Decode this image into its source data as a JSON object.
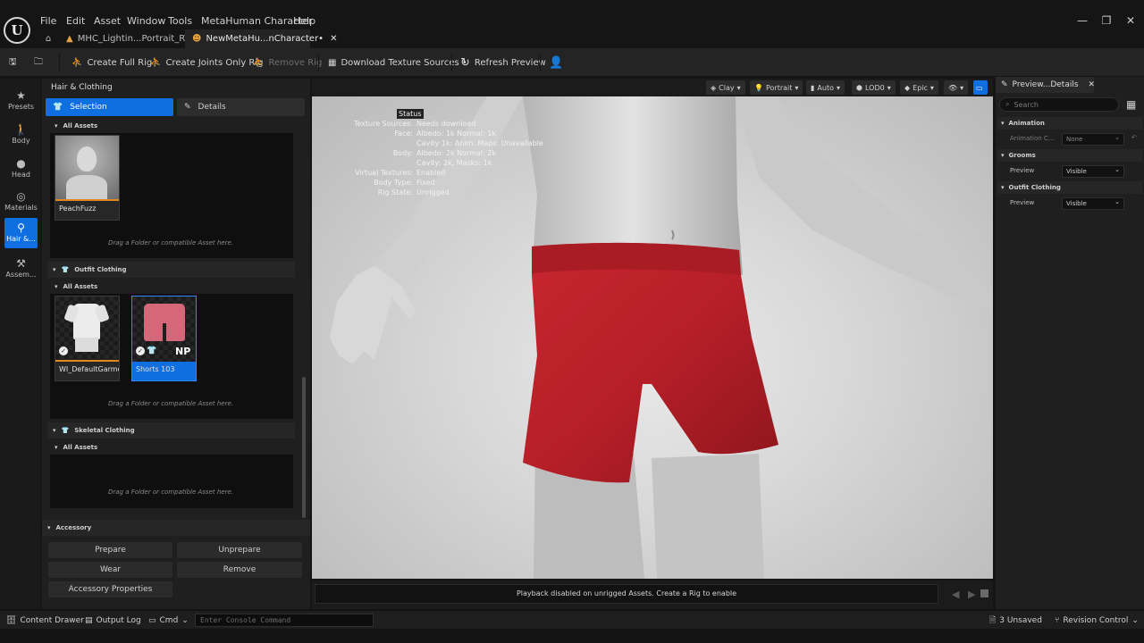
{
  "app": {
    "logo_text": "U"
  },
  "menu": [
    "File",
    "Edit",
    "Asset",
    "Window",
    "Tools",
    "MetaHuman Character",
    "Help"
  ],
  "tabs": [
    {
      "label": "MHC_Lightin...Portrait_RT",
      "active": false
    },
    {
      "label": "NewMetaHu...nCharacter•",
      "active": true
    }
  ],
  "toolbar": {
    "create_full_rig": "Create Full Rig",
    "create_joints_only_rig": "Create Joints Only Rig",
    "remove_rig": "Remove Rig",
    "download_texture_sources": "Download Texture Sources •",
    "refresh_preview": "Refresh Preview"
  },
  "modes": [
    {
      "label": "Presets",
      "icon": "star-icon"
    },
    {
      "label": "Body",
      "icon": "body-icon"
    },
    {
      "label": "Head",
      "icon": "head-icon"
    },
    {
      "label": "Materials",
      "icon": "materials-icon"
    },
    {
      "label": "Hair &...",
      "icon": "hair-icon",
      "active": true
    },
    {
      "label": "Assem...",
      "icon": "hammer-icon"
    }
  ],
  "left_panel": {
    "title": "Hair & Clothing",
    "selection_label": "Selection",
    "details_label": "Details",
    "all_assets": "All Assets",
    "drag_hint": "Drag a Folder or compatible Asset here.",
    "grooms": {
      "tile_name": "PeachFuzz"
    },
    "outfit": {
      "header": "Outfit Clothing",
      "tiles": [
        "WI_DefaultGarment",
        "Shorts 103"
      ],
      "badge": "NP"
    },
    "skeletal": {
      "header": "Skeletal Clothing"
    },
    "accessory": {
      "header": "Accessory",
      "prepare": "Prepare",
      "unprepare": "Unprepare",
      "wear": "Wear",
      "remove": "Remove",
      "properties": "Accessory Properties"
    }
  },
  "viewport": {
    "chips": [
      "Clay",
      "Portrait",
      "Auto",
      "LOD0",
      "Epic"
    ],
    "status": {
      "title": "Status",
      "rows": [
        {
          "k": "Texture Sources:",
          "v": "Needs download"
        },
        {
          "k": "Face:",
          "v": "Albedo: 1k Normal: 1k"
        },
        {
          "k": "",
          "v": "Cavity 1k: Anim. Maps: Unavailable"
        },
        {
          "k": "Body:",
          "v": "Albedo: 2k Normal: 2k"
        },
        {
          "k": "",
          "v": "Cavity: 2k, Masks: 1k"
        },
        {
          "k": "Virtual Textures:",
          "v": "Enabled"
        },
        {
          "k": "Body Type:",
          "v": "Fixed"
        },
        {
          "k": "Rig State:",
          "v": "Unrigged"
        }
      ]
    },
    "playback_msg": "Playback disabled on unrigged Assets. Create a Rig to enable"
  },
  "details_panel": {
    "tab": "Preview...Details",
    "search_placeholder": "Search",
    "animation": {
      "header": "Animation",
      "label": "Animation C...",
      "value": "None"
    },
    "grooms": {
      "header": "Grooms",
      "label": "Preview",
      "value": "Visible"
    },
    "outfit": {
      "header": "Outfit Clothing",
      "label": "Preview",
      "value": "Visible"
    }
  },
  "statusbar": {
    "content_drawer": "Content Drawer",
    "output_log": "Output Log",
    "cmd": "Cmd",
    "console_placeholder": "Enter Console Command",
    "unsaved": "3 Unsaved",
    "revision_control": "Revision Control"
  },
  "colors": {
    "accent": "#0f6fe0",
    "shorts": "#b8232b"
  }
}
